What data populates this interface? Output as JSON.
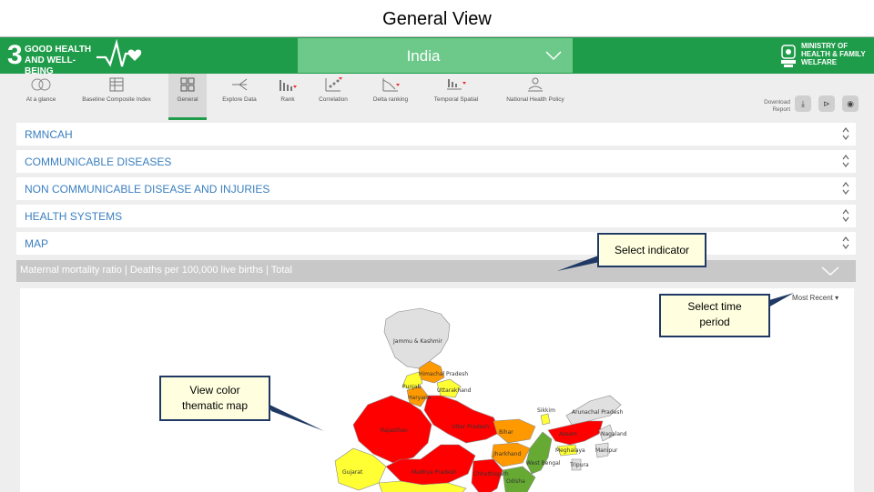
{
  "slide": {
    "title": "General View"
  },
  "header": {
    "sdg_number": "3",
    "sdg_line1": "GOOD HEALTH",
    "sdg_line2": "AND WELL-BEING",
    "country": "India",
    "ministry_line1": "MINISTRY OF",
    "ministry_line2": "HEALTH & FAMILY",
    "ministry_line3": "WELFARE",
    "brand_color": "#1f9c4a"
  },
  "toolbar": {
    "items": [
      {
        "label": "At a glance",
        "icon": "globe-icon"
      },
      {
        "label": "Baseline Composite Index",
        "icon": "table-icon"
      },
      {
        "label": "General",
        "icon": "grid-icon",
        "active": true
      },
      {
        "label": "Explore Data",
        "icon": "branch-icon"
      },
      {
        "label": "Rank",
        "icon": "bar-rank-icon"
      },
      {
        "label": "Correlation",
        "icon": "scatter-icon"
      },
      {
        "label": "Delta ranking",
        "icon": "delta-icon"
      },
      {
        "label": "Temporal Spatial",
        "icon": "temporal-icon"
      },
      {
        "label": "National Health Policy",
        "icon": "policy-icon"
      }
    ],
    "download_line1": "Download",
    "download_line2": "Report",
    "buttons": [
      "download-icon",
      "filter-icon",
      "user-icon"
    ]
  },
  "sections": [
    {
      "label": "RMNCAH"
    },
    {
      "label": "COMMUNICABLE DISEASES"
    },
    {
      "label": "NON COMMUNICABLE DISEASE AND INJURIES"
    },
    {
      "label": "HEALTH SYSTEMS"
    },
    {
      "label": "MAP"
    }
  ],
  "indicator": {
    "label": "Maternal mortality ratio | Deaths per 100,000 live births | Total"
  },
  "time_period": {
    "label": "Most Recent ▾"
  },
  "map": {
    "state_labels": [
      "Jammu & Kashmir",
      "Himachal Pradesh",
      "Punjab",
      "Uttarakhand",
      "Haryana",
      "Rajasthan",
      "Uttar Pradesh",
      "Bihar",
      "Sikkim",
      "Arunachal Pradesh",
      "Assam",
      "Meghalaya",
      "Nagaland",
      "Manipur",
      "Tripura",
      "Jharkhand",
      "West Bengal",
      "Gujarat",
      "Madhya Pradesh",
      "Chhattisgarh",
      "Odisha"
    ],
    "colors": {
      "high": "#ff0000",
      "mid": "#ff9900",
      "low": "#ffff33",
      "best": "#66aa33",
      "nodata": "#e0e0e0"
    }
  },
  "callouts": {
    "indicator": "Select indicator",
    "time_line1": "Select time",
    "time_line2": "period",
    "map_line1": "View color",
    "map_line2": "thematic map"
  }
}
